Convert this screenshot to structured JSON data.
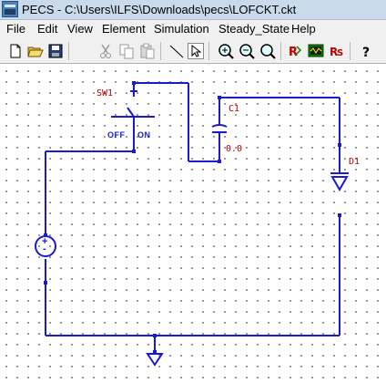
{
  "window": {
    "title": "PECS - C:\\Users\\ILFS\\Downloads\\pecs\\LOFCKT.ckt"
  },
  "menu": {
    "items": [
      "File",
      "Edit",
      "View",
      "Element",
      "Simulation",
      "Steady_State",
      "Help"
    ]
  },
  "toolbar": {
    "buttons": [
      {
        "name": "new-file-icon"
      },
      {
        "name": "open-folder-icon"
      },
      {
        "name": "save-disk-icon"
      },
      {
        "name": "cut-icon"
      },
      {
        "name": "copy-icon"
      },
      {
        "name": "paste-icon"
      },
      {
        "name": "wire-line-icon"
      },
      {
        "name": "select-arrow-icon",
        "pressed": true
      },
      {
        "name": "zoom-in-icon"
      },
      {
        "name": "zoom-out-icon"
      },
      {
        "name": "zoom-fit-icon"
      },
      {
        "name": "run-simulation-icon"
      },
      {
        "name": "waveform-display-icon"
      },
      {
        "name": "steady-state-icon"
      },
      {
        "name": "help-icon"
      }
    ]
  },
  "circuit": {
    "wire_color": "#1a1ad0",
    "label_color": "#b00000",
    "components": {
      "switch": {
        "label": "SW1",
        "state_off": "OFF",
        "state_on": "ON"
      },
      "capacitor": {
        "label": "C1",
        "value": "0.0"
      },
      "diode": {
        "label": "D1"
      },
      "source": {
        "plus": "+",
        "minus": "-"
      }
    }
  }
}
